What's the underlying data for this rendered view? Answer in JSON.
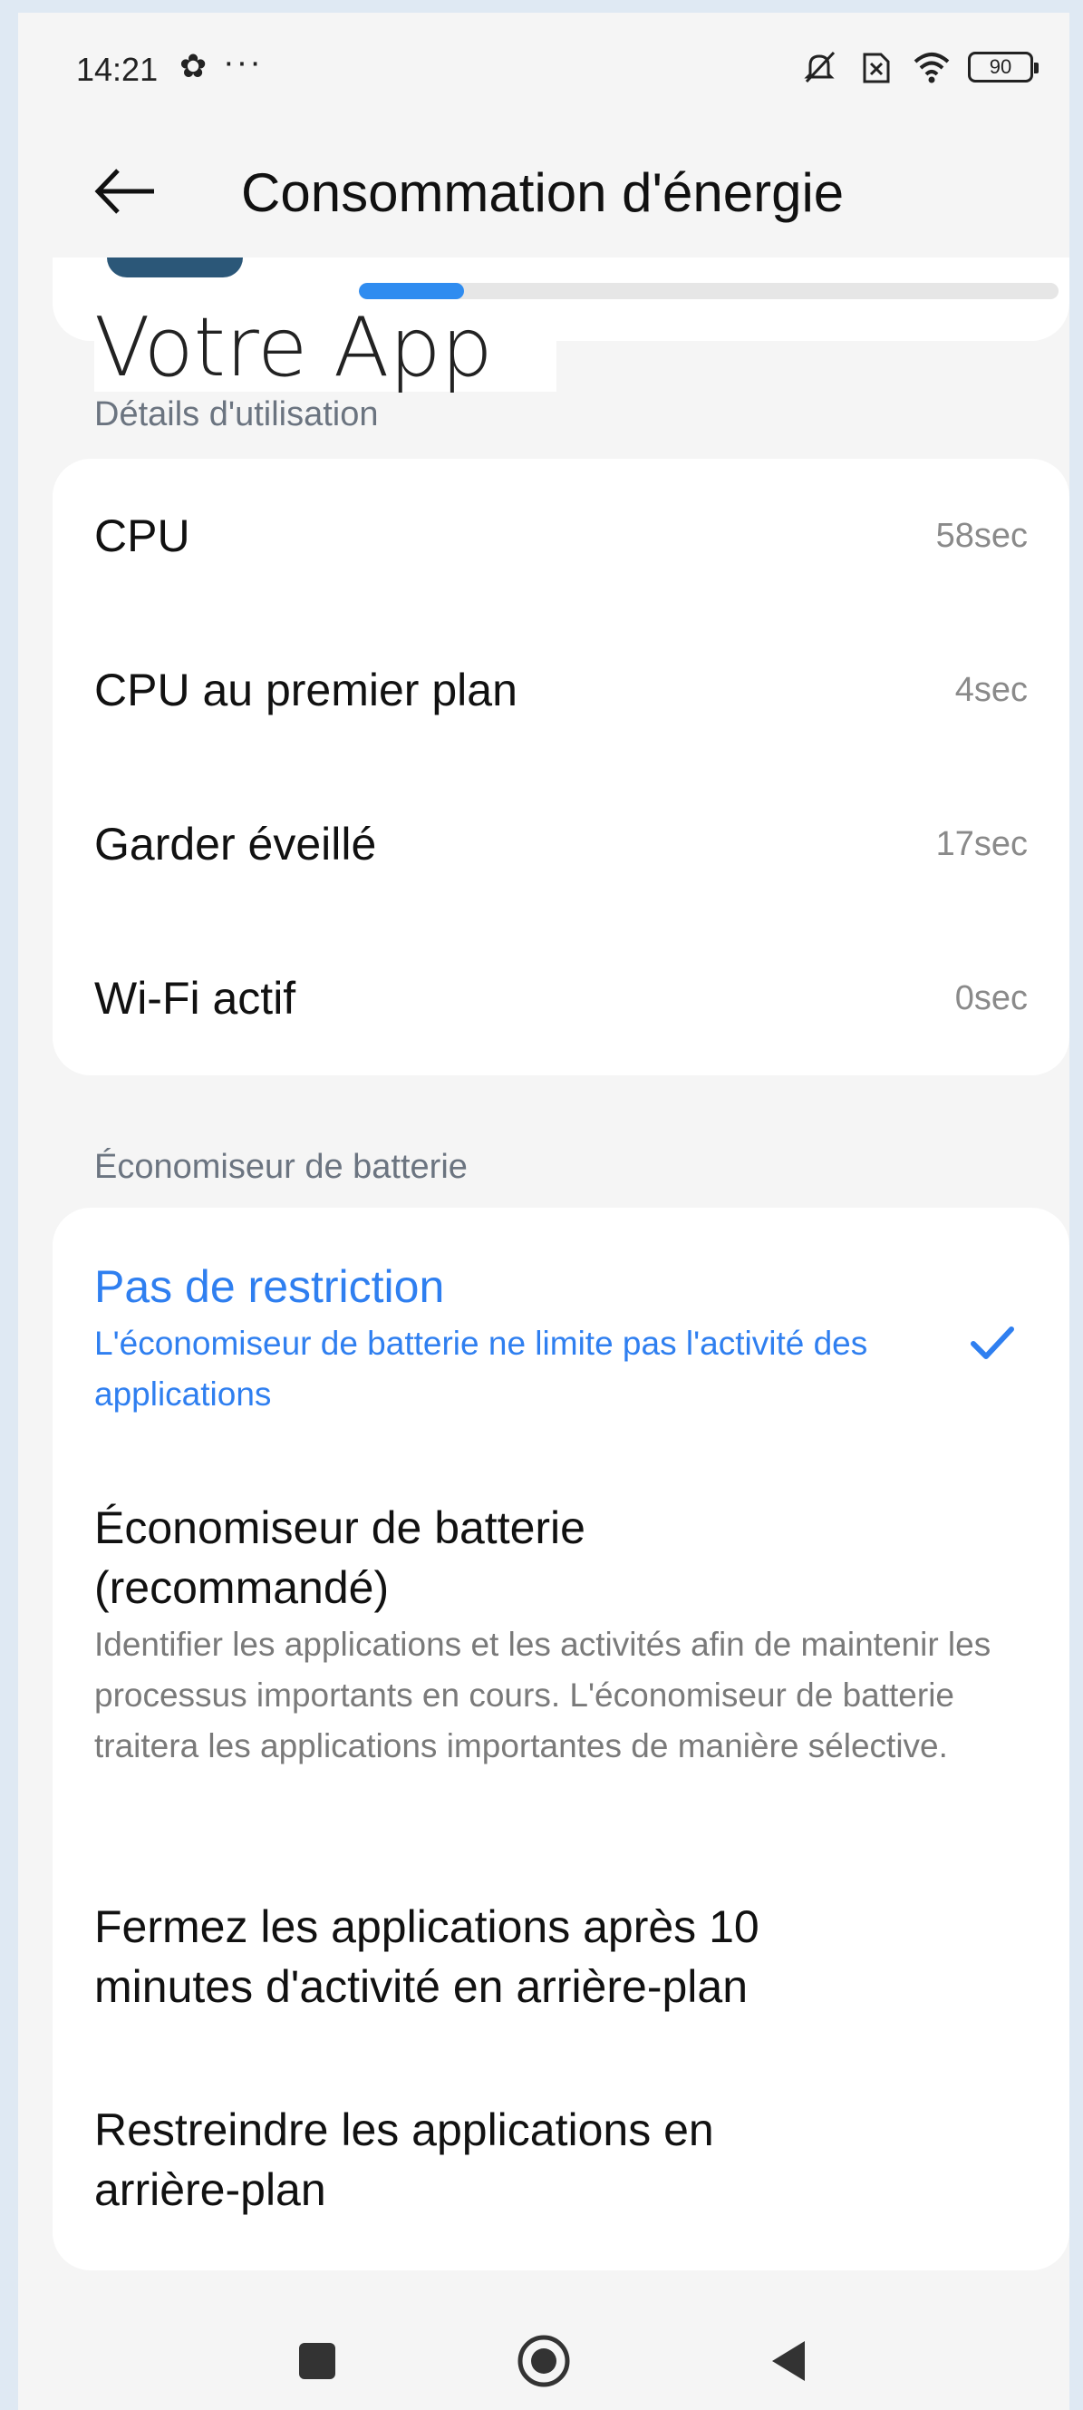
{
  "status_bar": {
    "time": "14:21",
    "dots": "···",
    "battery": "90"
  },
  "header": {
    "title": "Consommation d'énergie"
  },
  "overlay": {
    "label": "Votre App"
  },
  "usage_section": {
    "label": "Détails d'utilisation",
    "rows": [
      {
        "label": "CPU",
        "value": "58sec"
      },
      {
        "label": "CPU au premier plan",
        "value": "4sec"
      },
      {
        "label": "Garder éveillé",
        "value": "17sec"
      },
      {
        "label": "Wi-Fi actif",
        "value": "0sec"
      }
    ]
  },
  "saver_section": {
    "label": "Économiseur de batterie",
    "options": [
      {
        "title": "Pas de restriction",
        "description": "L'économiseur de batterie ne limite pas l'activité des applications",
        "selected": true
      },
      {
        "title": "Économiseur de batterie (recommandé)",
        "description": "Identifier les applications et les activités afin de maintenir les processus importants en cours. L'économiseur de batterie traitera les applications importantes de manière sélective.",
        "selected": false
      },
      {
        "title": "Fermez les applications après 10 minutes d'activité en arrière-plan",
        "description": "",
        "selected": false
      },
      {
        "title": "Restreindre les applications en arrière-plan",
        "description": "",
        "selected": false
      }
    ]
  },
  "usage_progress": 0.15,
  "colors": {
    "accent": "#2f7ff0",
    "progress_fill": "#2f8cf0",
    "background": "#f5f5f5",
    "frame": "#dfe9f3"
  },
  "icons": {
    "status": [
      "gear-icon",
      "mute-icon",
      "sim-off-icon",
      "wifi-icon",
      "battery-icon"
    ],
    "header": [
      "back-arrow-icon"
    ],
    "nav": [
      "recents-square-icon",
      "home-circle-icon",
      "back-triangle-icon"
    ]
  }
}
